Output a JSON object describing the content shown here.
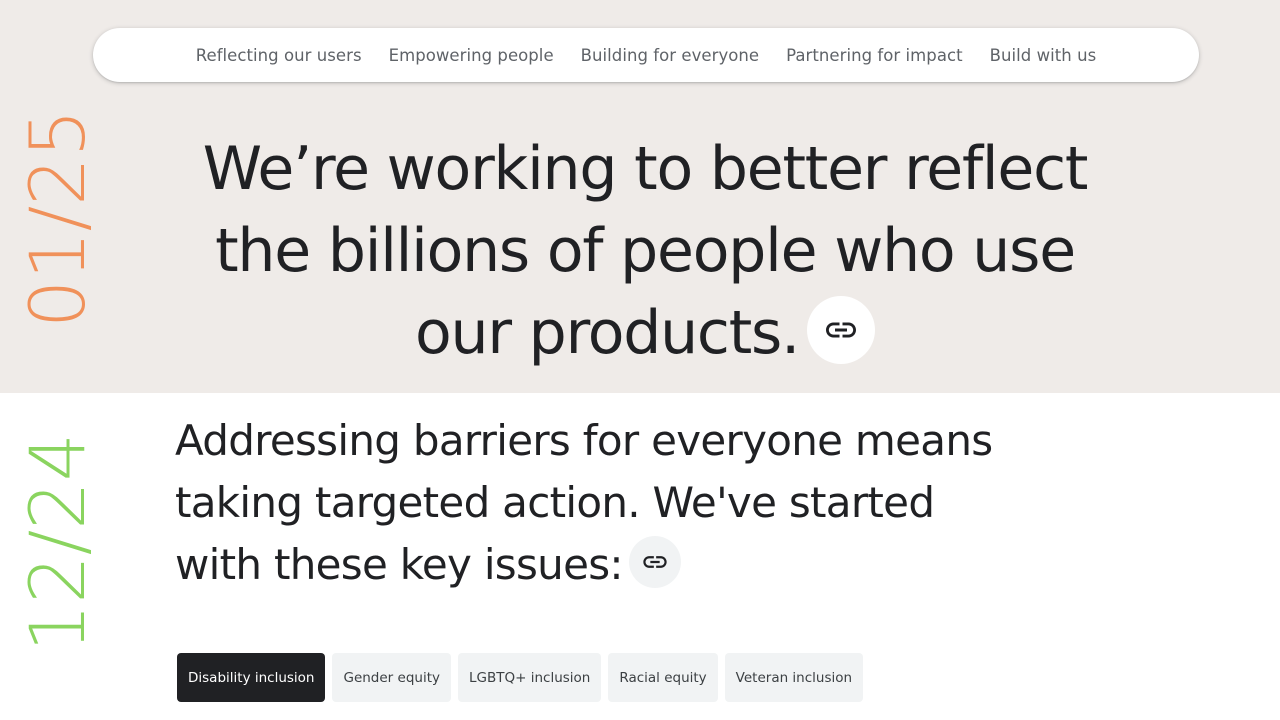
{
  "nav": {
    "items": [
      {
        "label": "Reflecting our users"
      },
      {
        "label": "Empowering people"
      },
      {
        "label": "Building for everyone"
      },
      {
        "label": "Partnering for impact"
      },
      {
        "label": "Build with us"
      }
    ]
  },
  "dates": {
    "top": "01/25",
    "bottom": "12/24",
    "top_color": "#f0915a",
    "bottom_color": "#8ad45f"
  },
  "hero": {
    "lines": [
      "We’re working to better reflect",
      "the billions of people who use",
      "our products."
    ],
    "link_icon": "link-icon"
  },
  "subheading": {
    "lines": [
      "Addressing barriers for everyone means",
      "taking targeted action. We've started",
      "with these key issues:"
    ],
    "link_icon": "link-icon"
  },
  "chips": [
    {
      "label": "Disability inclusion",
      "active": true
    },
    {
      "label": "Gender equity",
      "active": false
    },
    {
      "label": "LGBTQ+ inclusion",
      "active": false
    },
    {
      "label": "Racial equity",
      "active": false
    },
    {
      "label": "Veteran inclusion",
      "active": false
    }
  ],
  "colors": {
    "top_background": "#efebe8",
    "text": "#202124",
    "chip_active": "#202124",
    "chip_inactive": "#f1f3f4"
  }
}
